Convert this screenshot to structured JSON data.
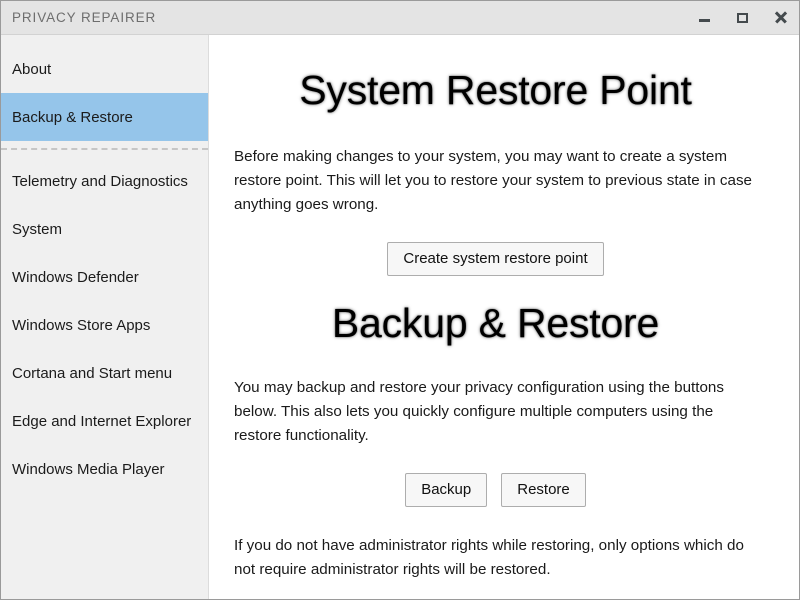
{
  "window": {
    "title": "PRIVACY REPAIRER",
    "controls": {
      "minimize": "minimize-icon",
      "maximize": "maximize-icon",
      "close": "close-icon"
    }
  },
  "colors": {
    "titlebar_bg": "#E4E4E4",
    "title_text": "#6E6E6E",
    "sidebar_bg": "#F0F0F0",
    "selection_bg": "#95C5EA",
    "content_bg": "#FFFFFF",
    "button_bg": "#F7F7F7",
    "button_border": "#ADADAD",
    "separator": "#C6C6C6",
    "window_border": "#9A9A9A"
  },
  "sidebar": {
    "group_top": [
      {
        "label": "About",
        "selected": false
      },
      {
        "label": "Backup & Restore",
        "selected": true
      }
    ],
    "group_bottom": [
      {
        "label": "Telemetry and Diagnostics",
        "selected": false
      },
      {
        "label": "System",
        "selected": false
      },
      {
        "label": "Windows Defender",
        "selected": false
      },
      {
        "label": "Windows Store Apps",
        "selected": false
      },
      {
        "label": "Cortana and Start menu",
        "selected": false
      },
      {
        "label": "Edge and Internet Explorer",
        "selected": false
      },
      {
        "label": "Windows Media Player",
        "selected": false
      }
    ]
  },
  "content": {
    "restore_point": {
      "heading": "System Restore Point",
      "paragraph": "Before making changes to your system, you may want to create a system restore point. This will let you to restore your system to previous state in case anything goes wrong.",
      "button": "Create system restore point"
    },
    "backup_restore": {
      "heading": "Backup & Restore",
      "paragraph": "You may backup and restore your privacy configuration using the buttons below. This also lets you quickly configure multiple computers using the restore functionality.",
      "backup_button": "Backup",
      "restore_button": "Restore",
      "note": "If you do not have administrator rights while restoring, only options which do not require administrator rights will be restored."
    }
  }
}
